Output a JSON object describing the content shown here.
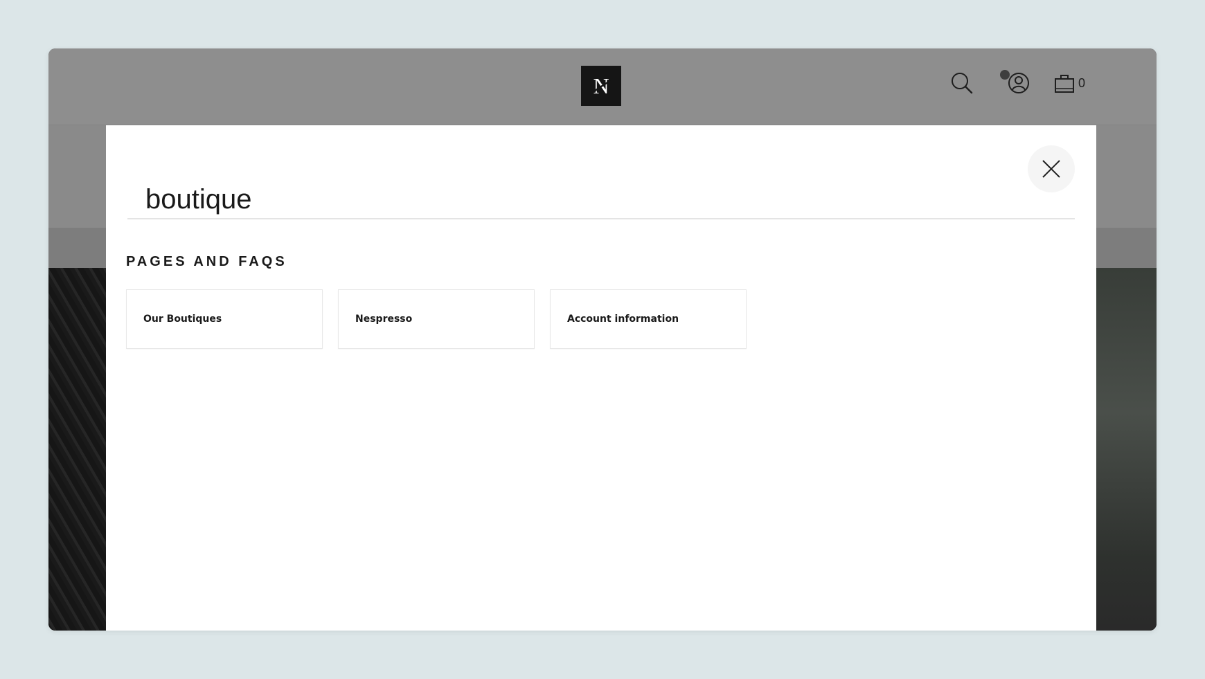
{
  "header": {
    "logo_letter": "N",
    "cart_count": "0"
  },
  "search": {
    "value": "boutique"
  },
  "results": {
    "heading": "PAGES AND FAQS",
    "items": [
      {
        "label": "Our Boutiques"
      },
      {
        "label": "Nespresso"
      },
      {
        "label": "Account information"
      }
    ]
  },
  "icons": {
    "search": "search-icon",
    "account": "user-icon",
    "cart": "shopping-bag-icon",
    "close": "close-icon"
  },
  "colors": {
    "page_background": "#dce6e8",
    "overlay_header": "#8e8e8e",
    "modal_background": "#ffffff",
    "logo_background": "#151515"
  }
}
